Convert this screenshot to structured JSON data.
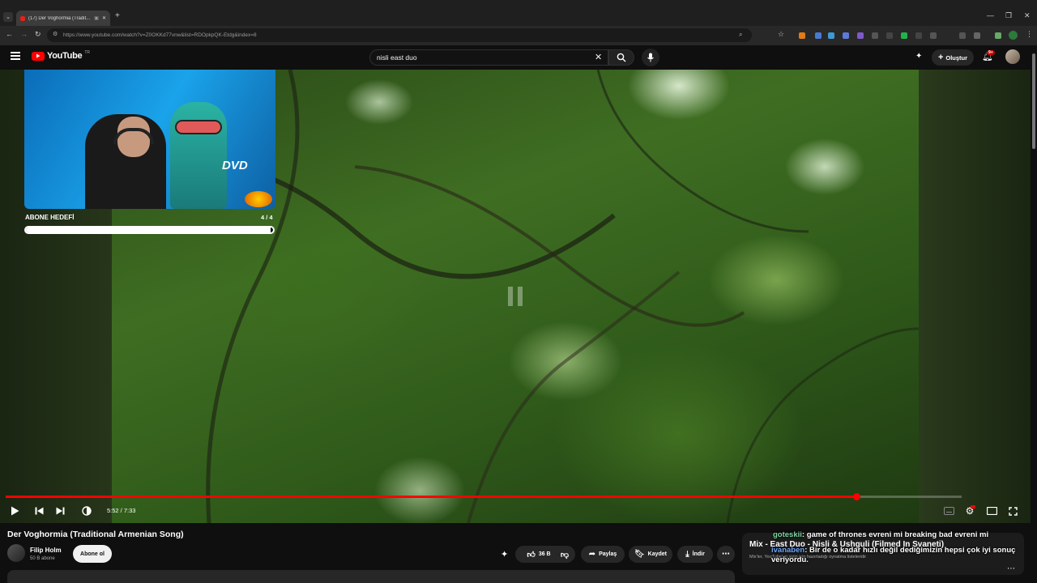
{
  "browser": {
    "tab_title": "(17) Der Voghormia (Tradit...",
    "url": "https://www.youtube.com/watch?v=Z0OKKd77vnw&list=RDOpkpQK-Etdg&index=8"
  },
  "header": {
    "logo_text": "YouTube",
    "region": "TR",
    "search_query": "nisli east duo",
    "create_label": "Oluştur",
    "notification_count": "9+"
  },
  "overlay": {
    "goal_label": "ABONE HEDEFİ",
    "goal_count": "4 / 4",
    "goal_progress": 0.99
  },
  "player": {
    "time": "5:52 / 7:33",
    "progress": 0.89
  },
  "video": {
    "title": "Der Voghormia (Traditional Armenian Song)",
    "channel": "Filip Holm",
    "subscribers": "50 B abone",
    "subscribe_label": "Abone ol",
    "likes": "36 B",
    "share_label": "Paylaş",
    "save_label": "Kaydet",
    "download_label": "İndir"
  },
  "playlist": {
    "title": "Mix - East Duo - Nisli & Ushguli (Filmed In Svaneti)",
    "subtitle": "Mix'ler, YouTube'un sizin için hazırladığı oynatma listeleridir"
  },
  "chat": [
    {
      "user": "goteskii",
      "message": ": game of thrones evreni mi breaking bad evreni mi",
      "color": "#7fd6a0"
    },
    {
      "user": "ivanaben",
      "message": ": Bir de o kadar hızlı değil dediğimizin hepsi çok iyi sonuç veriyordu.",
      "color": "#6fa8ff"
    }
  ],
  "colors": {
    "accent": "#ff0000",
    "background": "#0f0f0f"
  }
}
